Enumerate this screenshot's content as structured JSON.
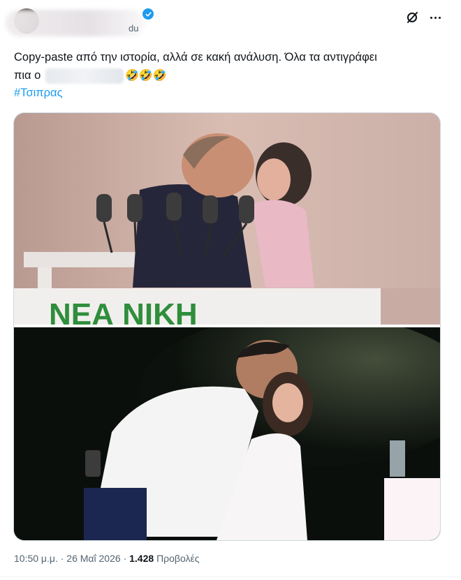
{
  "author": {
    "handle_fragment": "du",
    "verified": true
  },
  "post": {
    "text_line1": "Copy-paste από την ιστορία, αλλά σε κακή ανάλυση. Όλα τα αντιγράφει",
    "text_line2_prefix": "πια ο",
    "emojis": "🤣🤣🤣",
    "hashtag": "#Τσιπρας"
  },
  "media": {
    "top_image_banner_text": "ΝΕΑ ΝΙΚΗ"
  },
  "meta": {
    "time": "10:50 μ.μ.",
    "separator": "·",
    "date": "26 Μαΐ 2026",
    "views_count": "1.428",
    "views_label": "Προβολές"
  },
  "icons": [
    "verified-badge-icon",
    "grok-icon",
    "more-icon"
  ],
  "colors": {
    "accent": "#1d9bf0",
    "text": "#0f1419",
    "secondary": "#536471"
  }
}
